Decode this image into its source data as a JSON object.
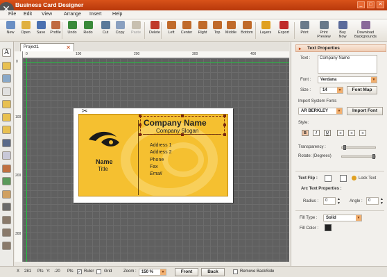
{
  "window": {
    "title": "Business Card Designer",
    "close_badge": "✕",
    "controls": [
      "_",
      "□",
      "✕"
    ]
  },
  "menu": [
    "File",
    "Edit",
    "View",
    "Arrange",
    "Insert",
    "Help"
  ],
  "toolbar": [
    {
      "label": "New",
      "icon": "new-file-icon",
      "color": "#6a8fc4",
      "enabled": true
    },
    {
      "label": "Open",
      "icon": "open-folder-icon",
      "color": "#e0b040",
      "enabled": true
    },
    {
      "label": "Save",
      "icon": "save-icon",
      "color": "#4a70b0",
      "enabled": true
    },
    {
      "label": "Profile",
      "icon": "profile-icon",
      "color": "#c06a40",
      "enabled": true
    },
    {
      "label": "Undo",
      "icon": "undo-icon",
      "color": "#3a8a3a",
      "enabled": true
    },
    {
      "label": "Redo",
      "icon": "redo-icon",
      "color": "#3a8a3a",
      "enabled": true
    },
    {
      "label": "Cut",
      "icon": "cut-icon",
      "color": "#5a7a9a",
      "enabled": true
    },
    {
      "label": "Copy",
      "icon": "copy-icon",
      "color": "#8aa0c0",
      "enabled": true
    },
    {
      "label": "Paste",
      "icon": "paste-icon",
      "color": "#c8c0b0",
      "enabled": false
    },
    {
      "label": "Delete",
      "icon": "delete-icon",
      "color": "#c03a2a",
      "enabled": true
    },
    {
      "label": "Left",
      "icon": "align-left-icon",
      "color": "#c06a2a",
      "enabled": true
    },
    {
      "label": "Center",
      "icon": "align-center-icon",
      "color": "#c06a2a",
      "enabled": true
    },
    {
      "label": "Right",
      "icon": "align-right-icon",
      "color": "#c06a2a",
      "enabled": true
    },
    {
      "label": "Top",
      "icon": "align-top-icon",
      "color": "#c06a2a",
      "enabled": true
    },
    {
      "label": "Middle",
      "icon": "align-middle-icon",
      "color": "#c06a2a",
      "enabled": true
    },
    {
      "label": "Bottom",
      "icon": "align-bottom-icon",
      "color": "#c06a2a",
      "enabled": true
    },
    {
      "label": "Layers",
      "icon": "layers-icon",
      "color": "#e0a020",
      "enabled": true
    },
    {
      "label": "Export",
      "icon": "export-icon",
      "color": "#c02a2a",
      "enabled": true
    },
    {
      "label": "Print",
      "icon": "print-icon",
      "color": "#6a7a8a",
      "enabled": true
    },
    {
      "label": "Print\nPreview",
      "icon": "print-preview-icon",
      "color": "#6a7a8a",
      "enabled": true
    },
    {
      "label": "Buy\nNow",
      "icon": "cart-icon",
      "color": "#5a6a9a",
      "enabled": true
    },
    {
      "label": "Download\nBackgrounds",
      "icon": "download-icon",
      "color": "#8a6a9a",
      "enabled": true
    }
  ],
  "left_tools": [
    {
      "icon": "text-tool-icon",
      "color": "#ffffff"
    },
    {
      "icon": "folder-icon",
      "color": "#e8c050"
    },
    {
      "icon": "image-icon",
      "color": "#88a8c8"
    },
    {
      "icon": "star-icon",
      "color": "#e0e0e0"
    },
    {
      "icon": "shapes-icon",
      "color": "#e8c050"
    },
    {
      "icon": "folder-open-icon",
      "color": "#e8c050"
    },
    {
      "icon": "folder-icon",
      "color": "#e8c050"
    },
    {
      "icon": "barcode-icon",
      "color": "#5a6a8a"
    },
    {
      "icon": "crop-icon",
      "color": "#c8c8d8"
    },
    {
      "icon": "paint-icon",
      "color": "#c07040"
    },
    {
      "icon": "color-palette-icon",
      "color": "#5a9a5a"
    },
    {
      "icon": "pen-icon",
      "color": "#d0a060"
    },
    {
      "icon": "fill-icon",
      "color": "#6a6a6a"
    },
    {
      "icon": "lock-icon",
      "color": "#8a7a6a"
    },
    {
      "icon": "settings-icon",
      "color": "#8a7a6a"
    },
    {
      "icon": "help-icon",
      "color": "#8a7a6a"
    }
  ],
  "document_tab": {
    "label": "Project1",
    "close": "✕"
  },
  "ruler": {
    "h_ticks": [
      "0",
      "100",
      "200",
      "300",
      "400"
    ],
    "v_ticks": [
      "0",
      "100",
      "200",
      "300"
    ]
  },
  "card": {
    "company_name": "Company Name",
    "slogan": "Company Slogan",
    "name": "Name",
    "title": "Title",
    "address1": "Address 1",
    "address2": "Address 2",
    "phone": "Phone",
    "fax": "Fax",
    "email": "Email",
    "bg_color": "#f5c030"
  },
  "panel": {
    "header": "Text Properties",
    "text_label": "Text :",
    "text_value": "Company Name",
    "font_label": "Font :",
    "font_value": "Verdana",
    "size_label": "Size :",
    "size_value": "14",
    "font_map_button": "Font Map",
    "import_system_fonts": "Import System Fonts",
    "system_font_value": "AR BERKLEY",
    "import_font_button": "Import Font",
    "style_label": "Style:",
    "style_buttons": [
      "B",
      "I",
      "U",
      "≡",
      "≡",
      "≡"
    ],
    "transparency_label": "Transparency :",
    "transparency_value": 0.05,
    "rotate_label": "Rotate: (Degrees)",
    "rotate_value": 0.95,
    "text_flip_label": "Text Flip :",
    "lock_text_label": "Lock Text",
    "arc_header": "Arc Text Properties :",
    "radius_label": "Radius :",
    "radius_value": "0",
    "angle_label": "Angle :",
    "angle_value": "0",
    "fill_type_label": "Fill Type :",
    "fill_type_value": "Solid",
    "fill_color_label": "Fill Color :",
    "fill_color": "#222222"
  },
  "status": {
    "x_label": "X",
    "x_value": "281",
    "x_unit": "Pts",
    "y_label": "Y:",
    "y_value": "-20",
    "y_unit": "Pts",
    "ruler_label": "Ruler",
    "ruler_checked": true,
    "grid_label": "Grid",
    "grid_checked": false,
    "zoom_label": "Zoom :",
    "zoom_value": "150 %",
    "front_button": "Front",
    "back_button": "Back",
    "remove_backside_label": "Remove BackSide"
  }
}
